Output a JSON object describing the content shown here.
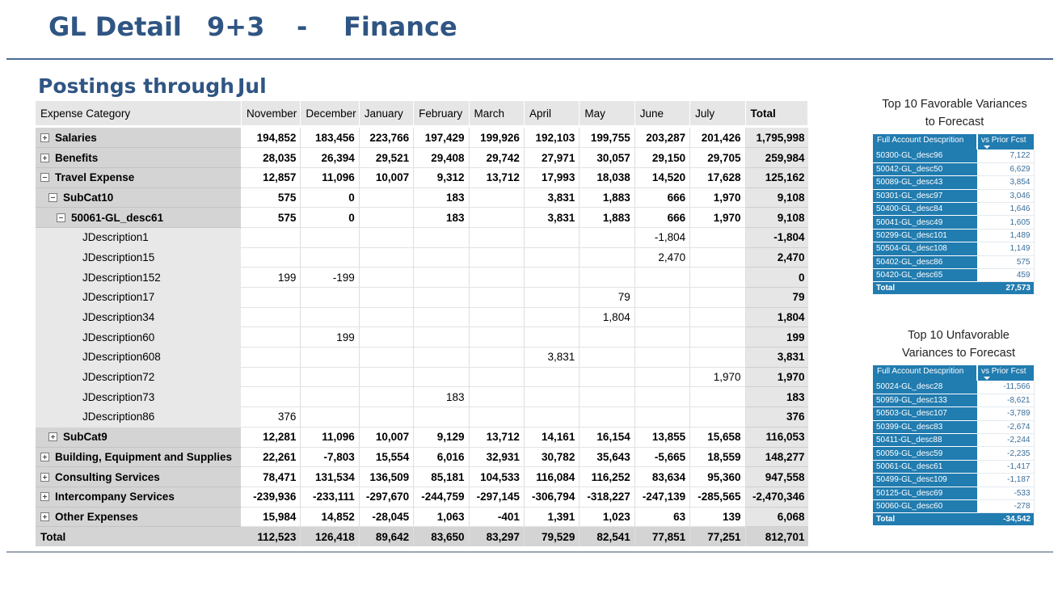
{
  "header": {
    "title": "GL Detail",
    "period": "9+3",
    "separator": "-",
    "department": "Finance"
  },
  "subheader": {
    "label": "Postings through",
    "month": "Jul"
  },
  "matrix": {
    "category_header": "Expense Category",
    "columns": [
      "November",
      "December",
      "January",
      "February",
      "March",
      "April",
      "May",
      "June",
      "July",
      "Total"
    ],
    "rows": [
      {
        "label": "Salaries",
        "values": [
          "194,852",
          "183,456",
          "223,766",
          "197,429",
          "199,926",
          "192,103",
          "199,755",
          "203,287",
          "201,426",
          "1,795,998"
        ]
      },
      {
        "label": "Benefits",
        "values": [
          "28,035",
          "26,394",
          "29,521",
          "29,408",
          "29,742",
          "27,971",
          "30,057",
          "29,150",
          "29,705",
          "259,984"
        ]
      },
      {
        "label": "Travel Expense",
        "values": [
          "12,857",
          "11,096",
          "10,007",
          "9,312",
          "13,712",
          "17,993",
          "18,038",
          "14,520",
          "17,628",
          "125,162"
        ]
      },
      {
        "label": "SubCat10",
        "values": [
          "575",
          "0",
          "",
          "183",
          "",
          "3,831",
          "1,883",
          "666",
          "1,970",
          "9,108"
        ]
      },
      {
        "label": "50061-GL_desc61",
        "values": [
          "575",
          "0",
          "",
          "183",
          "",
          "3,831",
          "1,883",
          "666",
          "1,970",
          "9,108"
        ]
      },
      {
        "label": "JDescription1",
        "values": [
          "",
          "",
          "",
          "",
          "",
          "",
          "",
          "-1,804",
          "",
          "-1,804"
        ]
      },
      {
        "label": "JDescription15",
        "values": [
          "",
          "",
          "",
          "",
          "",
          "",
          "",
          "2,470",
          "",
          "2,470"
        ]
      },
      {
        "label": "JDescription152",
        "values": [
          "199",
          "-199",
          "",
          "",
          "",
          "",
          "",
          "",
          "",
          "0"
        ]
      },
      {
        "label": "JDescription17",
        "values": [
          "",
          "",
          "",
          "",
          "",
          "",
          "79",
          "",
          "",
          "79"
        ]
      },
      {
        "label": "JDescription34",
        "values": [
          "",
          "",
          "",
          "",
          "",
          "",
          "1,804",
          "",
          "",
          "1,804"
        ]
      },
      {
        "label": "JDescription60",
        "values": [
          "",
          "199",
          "",
          "",
          "",
          "",
          "",
          "",
          "",
          "199"
        ]
      },
      {
        "label": "JDescription608",
        "values": [
          "",
          "",
          "",
          "",
          "",
          "3,831",
          "",
          "",
          "",
          "3,831"
        ]
      },
      {
        "label": "JDescription72",
        "values": [
          "",
          "",
          "",
          "",
          "",
          "",
          "",
          "",
          "1,970",
          "1,970"
        ]
      },
      {
        "label": "JDescription73",
        "values": [
          "",
          "",
          "",
          "183",
          "",
          "",
          "",
          "",
          "",
          "183"
        ]
      },
      {
        "label": "JDescription86",
        "values": [
          "376",
          "",
          "",
          "",
          "",
          "",
          "",
          "",
          "",
          "376"
        ]
      },
      {
        "label": "SubCat9",
        "values": [
          "12,281",
          "11,096",
          "10,007",
          "9,129",
          "13,712",
          "14,161",
          "16,154",
          "13,855",
          "15,658",
          "116,053"
        ]
      },
      {
        "label": "Building, Equipment and Supplies",
        "values": [
          "22,261",
          "-7,803",
          "15,554",
          "6,016",
          "32,931",
          "30,782",
          "35,643",
          "-5,665",
          "18,559",
          "148,277"
        ]
      },
      {
        "label": "Consulting Services",
        "values": [
          "78,471",
          "131,534",
          "136,509",
          "85,181",
          "104,533",
          "116,084",
          "116,252",
          "83,634",
          "95,360",
          "947,558"
        ]
      },
      {
        "label": "Intercompany Services",
        "values": [
          "-239,936",
          "-233,111",
          "-297,670",
          "-244,759",
          "-297,145",
          "-306,794",
          "-318,227",
          "-247,139",
          "-285,565",
          "-2,470,346"
        ]
      },
      {
        "label": "Other Expenses",
        "values": [
          "15,984",
          "14,852",
          "-28,045",
          "1,063",
          "-401",
          "1,391",
          "1,023",
          "63",
          "139",
          "6,068"
        ]
      }
    ],
    "grand_total": {
      "label": "Total",
      "values": [
        "112,523",
        "126,418",
        "89,642",
        "83,650",
        "83,297",
        "79,529",
        "82,541",
        "77,851",
        "77,251",
        "812,701"
      ]
    }
  },
  "favorable": {
    "title_line1": "Top 10 Favorable Variances",
    "title_line2": "to Forecast",
    "col_account": "Full Account Descprition",
    "col_value": "vs Prior Fcst",
    "rows": [
      {
        "account": "50300-GL_desc96",
        "value": "7,122"
      },
      {
        "account": "50042-GL_desc50",
        "value": "6,629"
      },
      {
        "account": "50089-GL_desc43",
        "value": "3,854"
      },
      {
        "account": "50301-GL_desc97",
        "value": "3,046"
      },
      {
        "account": "50400-GL_desc84",
        "value": "1,646"
      },
      {
        "account": "50041-GL_desc49",
        "value": "1,605"
      },
      {
        "account": "50299-GL_desc101",
        "value": "1,489"
      },
      {
        "account": "50504-GL_desc108",
        "value": "1,149"
      },
      {
        "account": "50402-GL_desc86",
        "value": "575"
      },
      {
        "account": "50420-GL_desc65",
        "value": "459"
      }
    ],
    "total_label": "Total",
    "total_value": "27,573"
  },
  "unfavorable": {
    "title_line1": "Top 10 Unfavorable",
    "title_line2": "Variances to Forecast",
    "col_account": "Full Account Descprition",
    "col_value": "vs Prior Fcst",
    "rows": [
      {
        "account": "50024-GL_desc28",
        "value": "-11,566"
      },
      {
        "account": "50959-GL_desc133",
        "value": "-8,621"
      },
      {
        "account": "50503-GL_desc107",
        "value": "-3,789"
      },
      {
        "account": "50399-GL_desc83",
        "value": "-2,674"
      },
      {
        "account": "50411-GL_desc88",
        "value": "-2,244"
      },
      {
        "account": "50059-GL_desc59",
        "value": "-2,235"
      },
      {
        "account": "50061-GL_desc61",
        "value": "-1,417"
      },
      {
        "account": "50499-GL_desc109",
        "value": "-1,187"
      },
      {
        "account": "50125-GL_desc69",
        "value": "-533"
      },
      {
        "account": "50060-GL_desc60",
        "value": "-278"
      }
    ],
    "total_label": "Total",
    "total_value": "-34,542"
  }
}
